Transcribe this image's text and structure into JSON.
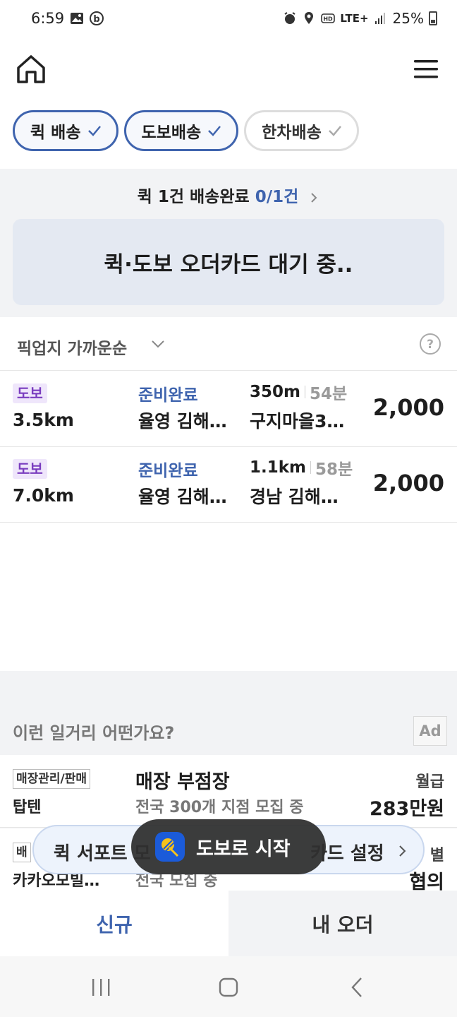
{
  "status_bar": {
    "time": "6:59",
    "network": "LTE+",
    "battery": "25%"
  },
  "filters": [
    {
      "label": "퀵 배송",
      "selected": true
    },
    {
      "label": "도보배송",
      "selected": true
    },
    {
      "label": "한차배송",
      "selected": false
    }
  ],
  "summary": {
    "text": "퀵 1건 배송완료",
    "count": "0/1건",
    "waiting_card": "퀵·도보 오더카드 대기 중.."
  },
  "sort": {
    "label": "픽업지 가까운순"
  },
  "orders": [
    {
      "type": "도보",
      "distance": "3.5km",
      "status": "준비완료",
      "pickup": "율영 김해…",
      "pickup_distance": "350m",
      "minutes": "54분",
      "destination": "구지마을3…",
      "price": "2,000"
    },
    {
      "type": "도보",
      "distance": "7.0km",
      "status": "준비완료",
      "pickup": "율영 김해…",
      "pickup_distance": "1.1km",
      "minutes": "58분",
      "destination": "경남 김해…",
      "price": "2,000"
    }
  ],
  "ads": {
    "title": "이런 일거리 어떤가요?",
    "badge": "Ad",
    "jobs": [
      {
        "category": "매장관리/판매",
        "company": "탑텐",
        "title": "매장 부점장",
        "description": "전국 300개 지점 모집 중",
        "pay_label": "월급",
        "pay": "283만원"
      },
      {
        "category": "배",
        "company": "카카오모빌…",
        "title": "",
        "description": "전국 모집 중",
        "pay_label": "별",
        "pay": "협의"
      }
    ]
  },
  "support_banner": {
    "text_left": "퀵 서포트 모",
    "text_right": "카드 설정"
  },
  "toast": {
    "label": "도보로 시작"
  },
  "tabs": [
    {
      "label": "신규",
      "active": true
    },
    {
      "label": "내 오더",
      "active": false
    }
  ],
  "colors": {
    "accent": "#3f64ae",
    "walk_tag": "#7a3dbf",
    "panel_bg": "#f2f3f5"
  }
}
